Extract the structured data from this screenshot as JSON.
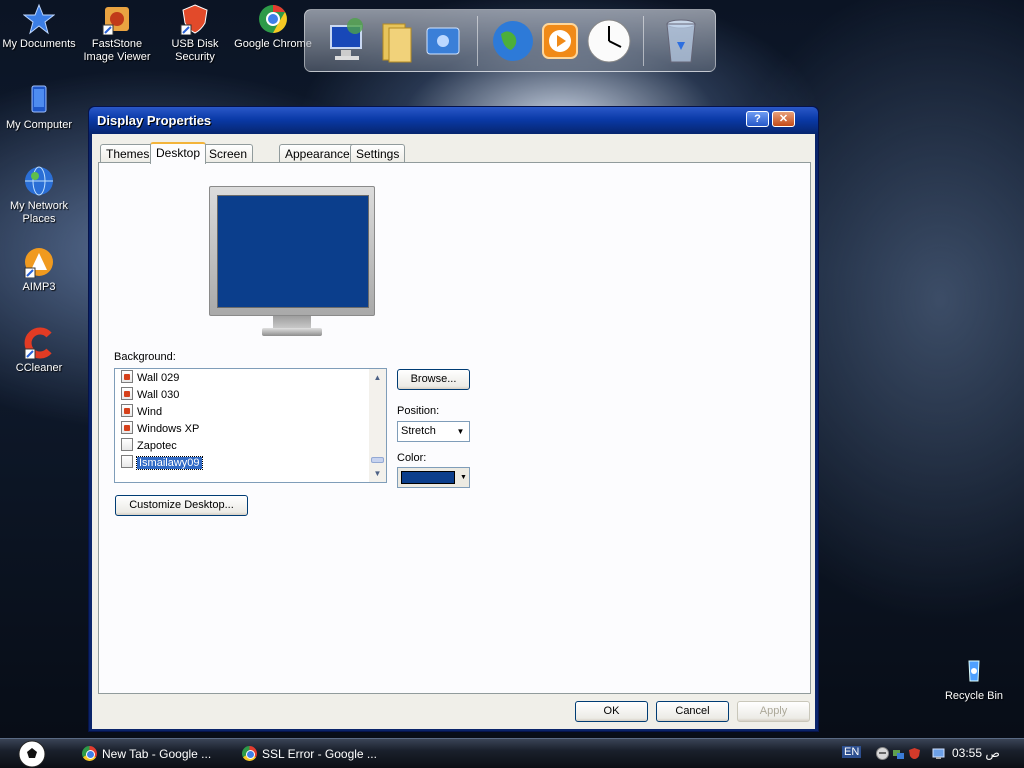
{
  "desktop": {
    "icons": [
      {
        "label": "My Documents"
      },
      {
        "label": "FastStone Image Viewer"
      },
      {
        "label": "USB Disk Security"
      },
      {
        "label": "Google Chrome"
      },
      {
        "label": "My Computer"
      },
      {
        "label": "My Network Places"
      },
      {
        "label": "AIMP3"
      },
      {
        "label": "CCleaner"
      },
      {
        "label": "Recycle Bin"
      }
    ]
  },
  "dialog": {
    "title": "Display Properties",
    "help_label": "?",
    "close_label": "✕",
    "tabs": [
      {
        "label": "Themes"
      },
      {
        "label": "Desktop"
      },
      {
        "label": "Screen Saver"
      },
      {
        "label": "Appearance"
      },
      {
        "label": "Settings"
      }
    ],
    "background_label": "Background:",
    "backgrounds": [
      {
        "label": "Wall 029"
      },
      {
        "label": "Wall 030"
      },
      {
        "label": "Wind"
      },
      {
        "label": "Windows XP"
      },
      {
        "label": "Zapotec"
      },
      {
        "label": "Ismailawy09"
      }
    ],
    "selected_background": "Ismailawy09",
    "browse_label": "Browse...",
    "position_label": "Position:",
    "position_value": "Stretch",
    "color_label": "Color:",
    "color_value": "#0b3e8c",
    "customize_label": "Customize Desktop...",
    "ok_label": "OK",
    "cancel_label": "Cancel",
    "apply_label": "Apply"
  },
  "taskbar": {
    "tasks": [
      {
        "label": "New Tab - Google ..."
      },
      {
        "label": "SSL Error - Google ..."
      }
    ],
    "language": "EN",
    "clock": "03:55 ص"
  },
  "colors": {
    "title_bar": "#0a3aa8",
    "desktop_preview": "#0b3e8c",
    "selection": "#316ac5"
  }
}
